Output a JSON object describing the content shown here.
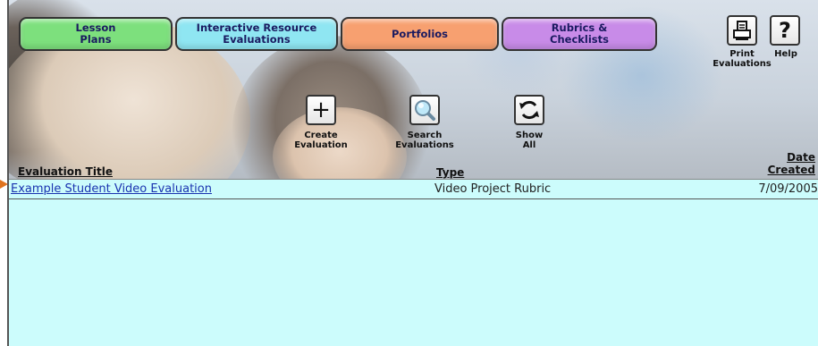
{
  "tabs": [
    {
      "label": "Lesson\nPlans",
      "color": "#7de07d"
    },
    {
      "label": "Interactive Resource\nEvaluations",
      "color": "#8fe6f2"
    },
    {
      "label": "Portfolios",
      "color": "#f7a070"
    },
    {
      "label": "Rubrics &\nChecklists",
      "color": "#c88be8"
    }
  ],
  "header_actions": {
    "print": {
      "icon": "printer-icon",
      "label": "Print\nEvaluations"
    },
    "help": {
      "icon": "question-mark-icon",
      "label": "Help"
    }
  },
  "toolbar": {
    "create": {
      "icon": "plus-icon",
      "label": "Create\nEvaluation"
    },
    "search": {
      "icon": "magnifier-icon",
      "label": "Search\nEvaluations"
    },
    "show_all": {
      "icon": "refresh-icon",
      "label": "Show\nAll"
    }
  },
  "columns": {
    "title": "Evaluation Title",
    "type": "Type",
    "date": "Date\nCreated"
  },
  "rows": [
    {
      "title": "Example Student Video Evaluation",
      "type": "Video Project Rubric",
      "date": "7/09/2005"
    }
  ],
  "colors": {
    "list_background": "#ccfcfc",
    "link": "#1a33b0",
    "marker": "#e0741e"
  }
}
